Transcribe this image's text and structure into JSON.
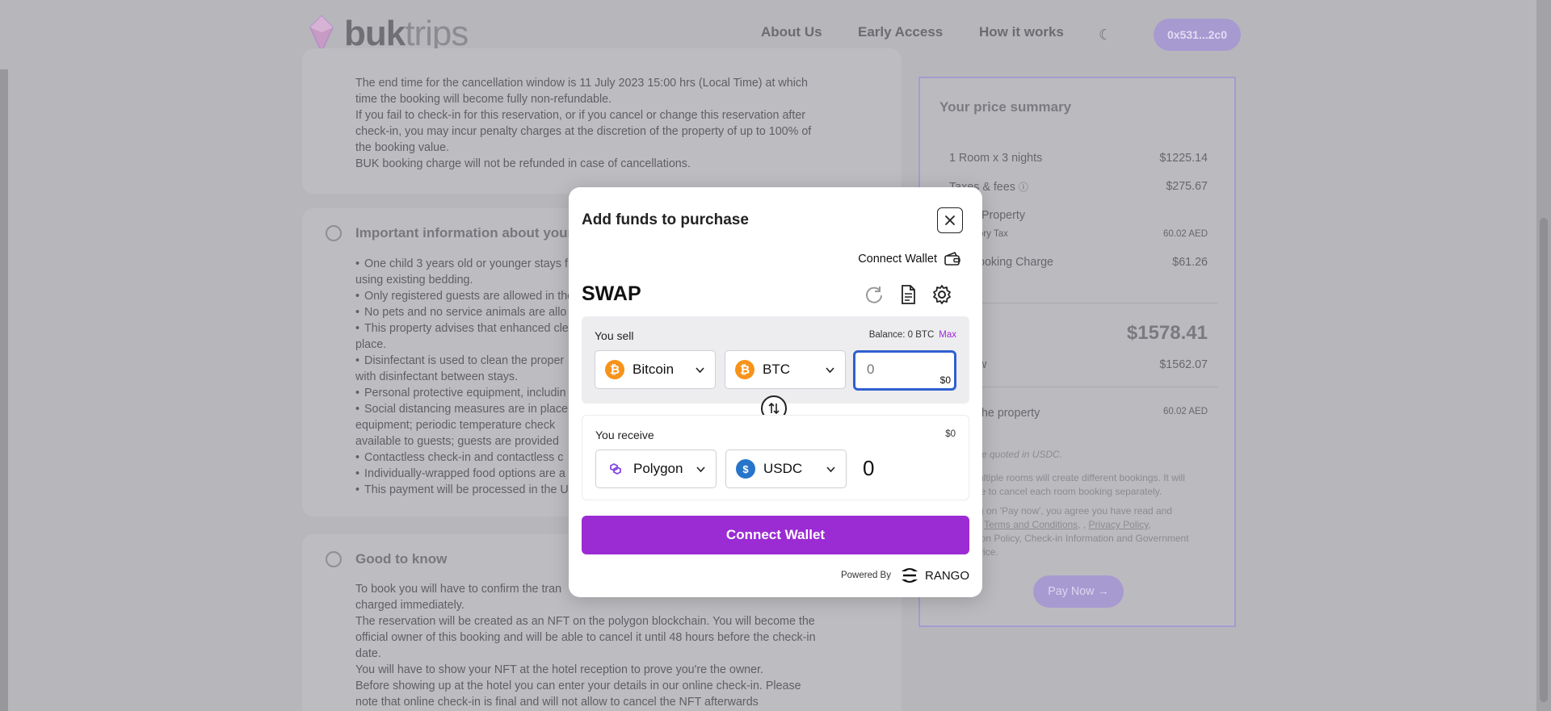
{
  "header": {
    "logo_bold": "buk",
    "logo_light": "trips",
    "nav": [
      "About Us",
      "Early Access",
      "How it works"
    ],
    "wallet_address": "0x531...2c0"
  },
  "cancellation": {
    "lines": [
      "The end time for the cancellation window is 11 July 2023 15:00 hrs (Local Time) at which",
      "time the booking will become fully non-refundable.",
      "If you fail to check-in for this reservation, or if you cancel or change this reservation after",
      "check-in, you may incur penalty charges at the discretion of the property of up to 100% of",
      "the booking value.",
      "BUK booking charge will not be refunded in case of cancellations."
    ]
  },
  "important": {
    "title": "Important information about your",
    "lines": [
      "One child 3 years old or younger stays f",
      "using existing bedding.",
      "Only registered guests are allowed in the",
      "No pets and no service animals are allo",
      "This property advises that enhanced cle",
      "place.",
      "Disinfectant is used to clean the proper",
      "with disinfectant between stays.",
      "Personal protective equipment, includin",
      "Social distancing measures are in place;",
      "equipment; periodic temperature check",
      "available to guests; guests are provided",
      "Contactless check-in and contactless c",
      "Individually-wrapped food options are a",
      "This payment will be processed in the U"
    ]
  },
  "good_to_know": {
    "title": "Good to know",
    "lines": [
      "To book you will have to confirm the tran",
      "charged immediately.",
      "The reservation will be created as an NFT on the polygon blockchain. You will become the",
      "official owner of this booking and will be able to cancel it until 48 hours before the check-in",
      "date.",
      "You will have to show your NFT at the hotel reception to prove you're the owner.",
      "Before showing up at the hotel you can enter your details in our online check-in. Please",
      "note that online check-in is final and will not allow to cancel the NFT afterwards"
    ]
  },
  "summary": {
    "title": "Your price summary",
    "rows": [
      {
        "label": "1 Room x 3 nights",
        "value": "$1225.14"
      },
      {
        "label": "Taxes & fees",
        "value": "$275.67"
      },
      {
        "label": ":Property",
        "value": ""
      },
      {
        "label": "ory Tax",
        "value": "60.02 AED"
      },
      {
        "label": "ooking Charge",
        "value": "$61.26"
      }
    ],
    "total_label": "l",
    "total_value": "$1578.41",
    "pay_now_label": "w",
    "pay_now_value": "$1562.07",
    "property_label": "the property",
    "property_value": "60.02 AED",
    "note_currency": "re quoted in USDC.",
    "note_rooms_1": "ultiple rooms will create different bookings. It will",
    "note_rooms_2": "le to cancel each room booking separately.",
    "note_terms_1": "g on 'Pay now', you agree you have read and",
    "note_terms_2a": "r",
    "note_terms_link1": "Terms and Conditions",
    "note_terms_sep": ", ,",
    "note_terms_link2": "Privacy Policy",
    "note_terms_2b": ",",
    "note_terms_3": "ion Policy, Check-in Information and Government",
    "note_terms_4": "vice.",
    "pay_button": "Pay Now"
  },
  "modal": {
    "title": "Add funds to purchase",
    "connect_wallet_link": "Connect Wallet",
    "swap_title": "SWAP",
    "sell": {
      "label": "You sell",
      "balance": "Balance: 0 BTC",
      "max": "Max",
      "chain": "Bitcoin",
      "token": "BTC",
      "amount_placeholder": "0",
      "usd_value": "$0"
    },
    "receive": {
      "label": "You receive",
      "usd_value": "$0",
      "chain": "Polygon",
      "token": "USDC",
      "amount": "0"
    },
    "connect_button": "Connect Wallet",
    "powered_by": "Powered By",
    "provider": "RANGO"
  },
  "colors": {
    "accent": "#9b2bd3",
    "focus_border": "#2f5fd0",
    "bitcoin": "#f7931a",
    "usdc": "#2775ca",
    "polygon": "#8247e5"
  }
}
